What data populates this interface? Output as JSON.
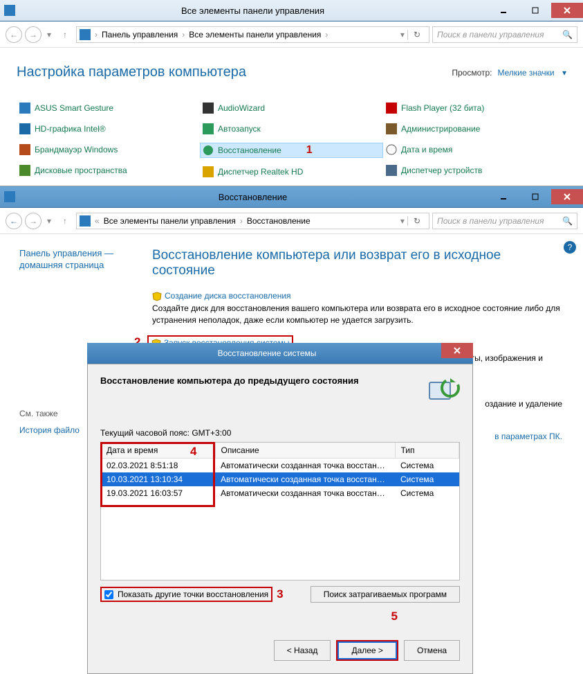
{
  "w1": {
    "title": "Все элементы панели управления",
    "breadcrumbs": [
      "Панель управления",
      "Все элементы панели управления"
    ],
    "search_placeholder": "Поиск в панели управления",
    "heading": "Настройка параметров компьютера",
    "view_by_label": "Просмотр:",
    "view_by_value": "Мелкие значки",
    "items": {
      "c1": [
        "ASUS Smart Gesture",
        "HD-графика Intel®",
        "Брандмауэр Windows",
        "Дисковые пространства"
      ],
      "c2": [
        "AudioWizard",
        "Автозапуск",
        "Восстановление",
        "Диспетчер Realtek HD"
      ],
      "c3": [
        "Flash Player (32 бита)",
        "Администрирование",
        "Дата и время",
        "Диспетчер устройств"
      ]
    },
    "annot1": "1"
  },
  "w2": {
    "title": "Восстановление",
    "breadcrumbs": [
      "Все элементы панели управления",
      "Восстановление"
    ],
    "search_placeholder": "Поиск в панели управления",
    "side_head": "Панель управления — домашняя страница",
    "side_see_also": "См. также",
    "side_history": "История файло",
    "main_title": "Восстановление компьютера или возврат его в исходное состояние",
    "link1": "Создание диска восстановления",
    "para1": "Создайте диск для восстановления вашего компьютера или возврата его в исходное состояние либо для устранения неполадок, даже если компьютер не удается загрузить.",
    "link2": "Запуск восстановления системы",
    "para2": "Отмена последних изменений в системе; файлы пользователя, такие как документы, изображения и музыка, остаются без изменений.",
    "tail1": "оздание и удаление",
    "tail2": "в параметрах ПК.",
    "annot2": "2"
  },
  "dlg": {
    "title": "Восстановление системы",
    "header": "Восстановление компьютера до предыдущего состояния",
    "tz": "Текущий часовой пояс: GMT+3:00",
    "cols": {
      "date": "Дата и время",
      "desc": "Описание",
      "type": "Тип"
    },
    "rows": [
      {
        "date": "02.03.2021 8:51:18",
        "desc": "Автоматически созданная точка восстановле...",
        "type": "Система"
      },
      {
        "date": "10.03.2021 13:10:34",
        "desc": "Автоматически созданная точка восстановле...",
        "type": "Система"
      },
      {
        "date": "19.03.2021 16:03:57",
        "desc": "Автоматически созданная точка восстановле...",
        "type": "Система"
      }
    ],
    "selected_row": 1,
    "checkbox": "Показать другие точки восстановления",
    "btn_scan": "Поиск затрагиваемых программ",
    "btn_back": "< Назад",
    "btn_next": "Далее >",
    "btn_cancel": "Отмена",
    "annot3": "3",
    "annot4": "4",
    "annot5": "5"
  }
}
